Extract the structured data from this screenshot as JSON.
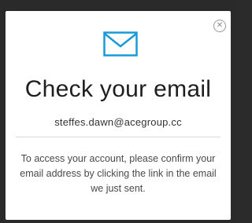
{
  "modal": {
    "close_icon": "close-icon",
    "icon": "envelope-icon",
    "title": "Check your email",
    "email": "steffes.dawn@acegroup.cc",
    "message": "To access your account, please confirm your email address by clicking the link in the email we just sent."
  },
  "colors": {
    "accent": "#1a9ad6",
    "title": "#1e1e1e",
    "backdrop": "#2a2a2a"
  }
}
